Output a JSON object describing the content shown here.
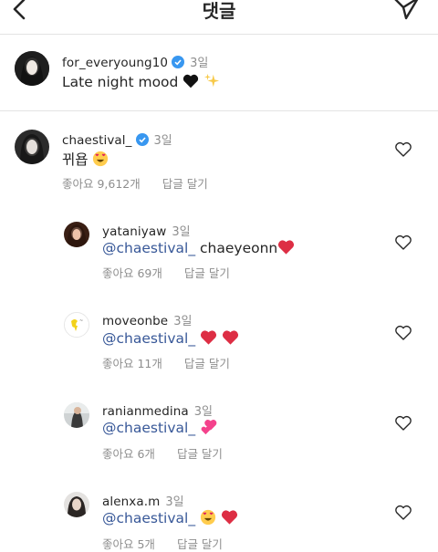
{
  "header": {
    "title": "댓글"
  },
  "caption": {
    "username": "for_everyoung10",
    "time": "3일",
    "text": "Late night mood",
    "emojis": [
      "black-heart",
      "sparkles"
    ]
  },
  "comment": {
    "username": "chaestival_",
    "time": "3일",
    "text": "뀌욥",
    "emoji": "heart-eyes-face",
    "likes": "좋아요 9,612개",
    "reply_label": "답글 달기"
  },
  "replies": [
    {
      "username": "yataniyaw",
      "time": "3일",
      "mention": "@chaestival_",
      "text": "chaeyeonn",
      "emojis": [
        "red-heart"
      ],
      "likes": "좋아요 69개",
      "reply_label": "답글 달기"
    },
    {
      "username": "moveonbe",
      "time": "3일",
      "mention": "@chaestival_",
      "text": "",
      "emojis": [
        "red-heart",
        "red-heart"
      ],
      "likes": "좋아요 11개",
      "reply_label": "답글 달기"
    },
    {
      "username": "ranianmedina",
      "time": "3일",
      "mention": "@chaestival_",
      "text": "",
      "emojis": [
        "two-hearts"
      ],
      "likes": "좋아요 6개",
      "reply_label": "답글 달기"
    },
    {
      "username": "alenxa.m",
      "time": "3일",
      "mention": "@chaestival_",
      "text": "",
      "emojis": [
        "heart-eyes-face",
        "red-heart"
      ],
      "likes": "좋아요 5개",
      "reply_label": "답글 달기"
    }
  ],
  "colors": {
    "mention": "#385898",
    "secondary_text": "#8e8e8e",
    "verified": "#3897f0"
  }
}
